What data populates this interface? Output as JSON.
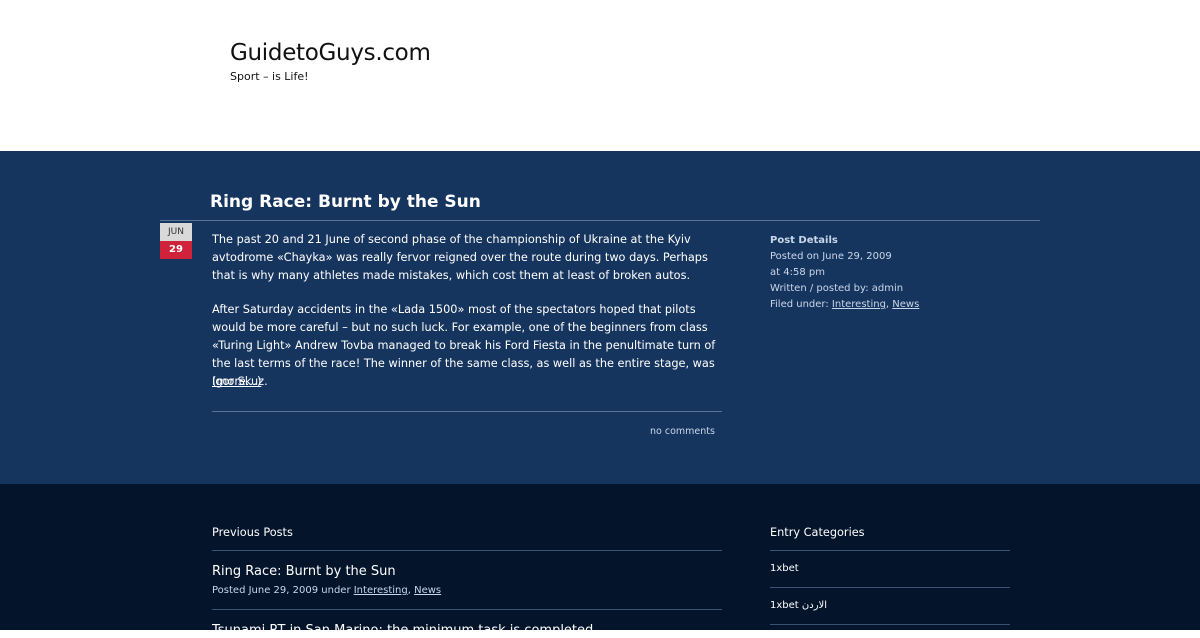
{
  "site": {
    "title": "GuidetoGuys.com",
    "tagline": "Sport – is Life!"
  },
  "post": {
    "title": "Ring Race: Burnt by the Sun",
    "date_month": "JUN",
    "date_day": "29",
    "paragraph_1": "The past 20 and 21 June of second phase of the championship of Ukraine at the Kyiv avtodrome «Chayka» was really fervor reigned over the route during two days. Perhaps that is why many athletes made mistakes, which cost them at least of broken autos.",
    "paragraph_2": "After Saturday accidents in the «Lada 1500» most of the spectators hoped that pilots would be more careful – but no such luck. For example, one of the beginners from class «Turing Light» Andrew Tovba managed to break his Ford Fiesta in the penultimate turn of the last terms of the race! The winner of the same class, as well as the entire stage, was Igor Skuz.",
    "more_label": "(more…)",
    "comments_label": "no comments"
  },
  "details": {
    "heading": "Post Details",
    "posted_on": "Posted on June 29, 2009",
    "posted_time": "at 4:58 pm",
    "written_by": "Written / posted by: admin",
    "filed_under_prefix": "Filed under: ",
    "category_1": "Interesting",
    "separator": ", ",
    "category_2": "News"
  },
  "footer": {
    "previous_heading": "Previous Posts",
    "previous_posts": [
      {
        "title": "Ring Race: Burnt by the Sun",
        "meta_prefix": "Posted June 29, 2009 under ",
        "category_1": "Interesting",
        "separator": ", ",
        "category_2": "News"
      },
      {
        "title": "Tsunami RT in San Marino: the minimum task is completed"
      }
    ],
    "categories_heading": "Entry Categories",
    "categories": [
      "1xbet",
      "1xbet الاردن"
    ]
  },
  "colors": {
    "main_band": "#16355e",
    "footer_band": "#04142b",
    "date_day_bg": "#d0233b",
    "date_month_bg": "#d9d9d9"
  }
}
